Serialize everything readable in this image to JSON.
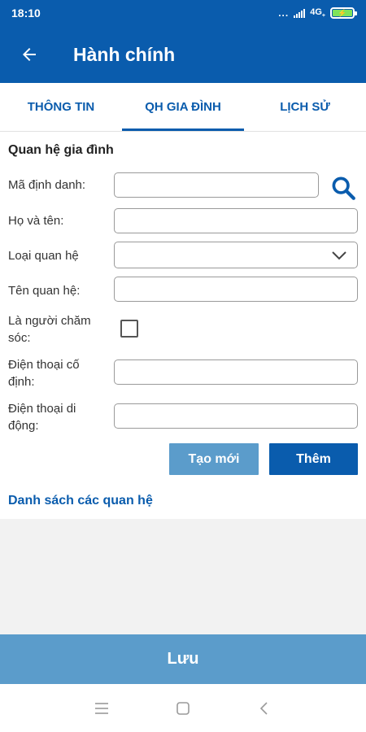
{
  "status_bar": {
    "time": "18:10",
    "dots": "...",
    "network": "4G",
    "network_sub": "+",
    "colors": {
      "background": "#0a5cad",
      "battery": "#7ee35a"
    }
  },
  "app_bar": {
    "title": "Hành chính",
    "back_icon": "arrow-left-icon",
    "color": "#0a5cad"
  },
  "tabs": [
    {
      "label": "THÔNG TIN",
      "active": false
    },
    {
      "label": "QH GIA ĐÌNH",
      "active": true
    },
    {
      "label": "LỊCH SỬ",
      "active": false
    }
  ],
  "form": {
    "section_title": "Quan hệ gia đình",
    "fields": {
      "ma_dinh_danh": {
        "label": "Mã định danh:",
        "value": "",
        "search_icon": "search-icon"
      },
      "ho_va_ten": {
        "label": "Họ và tên:",
        "value": ""
      },
      "loai_quan_he": {
        "label": "Loại quan hệ",
        "value": "",
        "icon": "chevron-down-icon"
      },
      "ten_quan_he": {
        "label": "Tên quan hệ:",
        "value": ""
      },
      "la_nguoi_cham_soc": {
        "label": "Là người chăm sóc:",
        "checked": false
      },
      "dien_thoai_co_dinh": {
        "label": "Điện thoại cố định:",
        "value": ""
      },
      "dien_thoai_di_dong": {
        "label": "Điện thoại di động:",
        "value": ""
      }
    },
    "buttons": {
      "new_label": "Tạo mới",
      "add_label": "Thêm"
    },
    "list_title": "Danh sách các quan hệ"
  },
  "footer": {
    "save_label": "Lưu",
    "color": "#5b9ccb"
  },
  "system_nav": {
    "icons": [
      "menu-icon",
      "home-square-icon",
      "back-chevron-icon"
    ]
  }
}
